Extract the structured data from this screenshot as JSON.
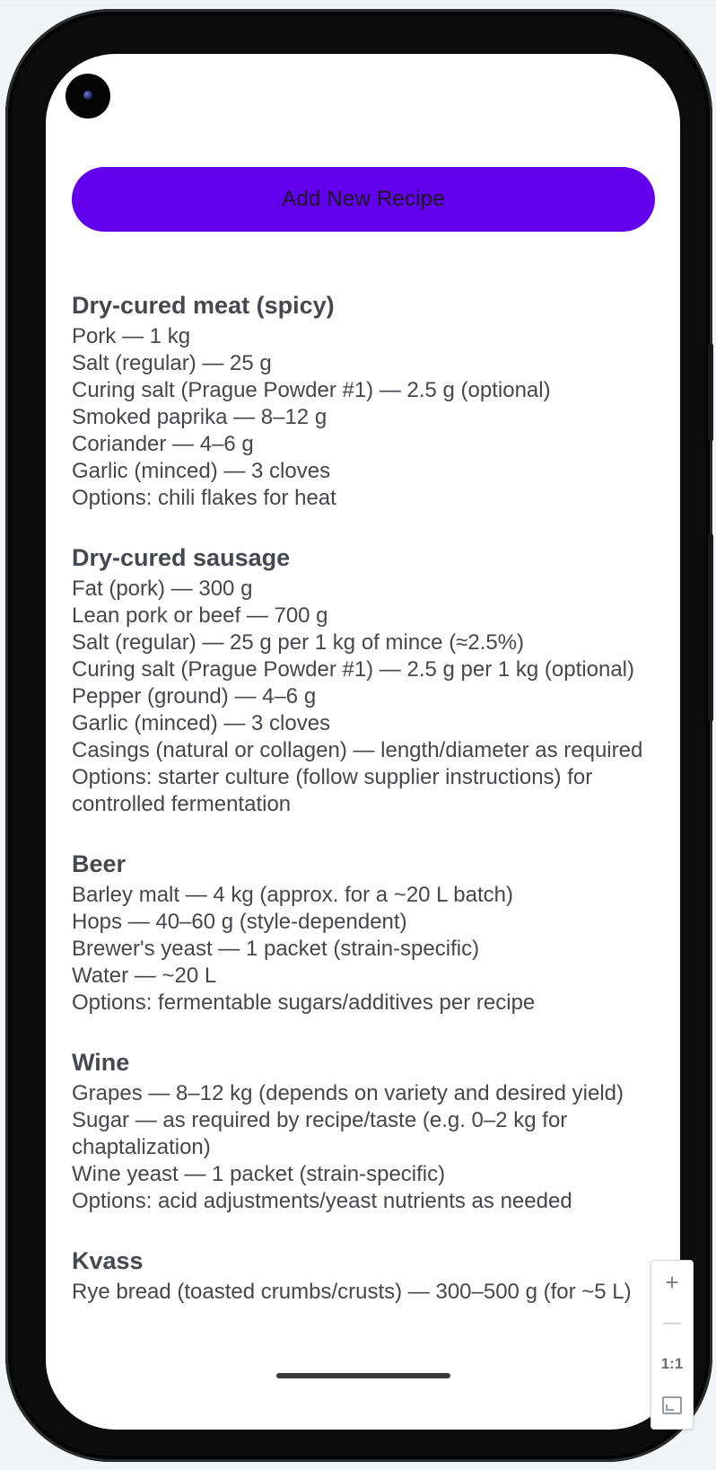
{
  "button": {
    "add_recipe": "Add New Recipe"
  },
  "recipes": [
    {
      "title": "Dry-cured meat (spicy)",
      "lines": [
        "Pork — 1 kg",
        "Salt (regular) — 25 g",
        "Curing salt (Prague Powder #1) — 2.5 g (optional)",
        "Smoked paprika — 8–12 g",
        "Coriander — 4–6 g",
        "Garlic (minced) — 3 cloves",
        "Options: chili flakes for heat"
      ]
    },
    {
      "title": "Dry-cured sausage",
      "lines": [
        "Fat (pork) — 300 g",
        "Lean pork or beef — 700 g",
        "Salt (regular) — 25 g per 1 kg of mince (≈2.5%)",
        "Curing salt (Prague Powder #1) — 2.5 g per 1 kg (optional)",
        "Pepper (ground) — 4–6 g",
        "Garlic (minced) — 3 cloves",
        "Casings (natural or collagen) — length/diameter as required",
        "Options: starter culture (follow supplier instructions) for controlled fermentation"
      ]
    },
    {
      "title": "Beer",
      "lines": [
        "Barley malt — 4 kg (approx. for a ~20 L batch)",
        "Hops — 40–60 g (style-dependent)",
        "Brewer's yeast — 1 packet (strain-specific)",
        "Water — ~20 L",
        "Options: fermentable sugars/additives per recipe"
      ]
    },
    {
      "title": "Wine",
      "lines": [
        "Grapes — 8–12 kg (depends on variety and desired yield)",
        "Sugar — as required by recipe/taste (e.g. 0–2 kg for chaptalization)",
        "Wine yeast — 1 packet (strain-specific)",
        "Options: acid adjustments/yeast nutrients as needed"
      ]
    },
    {
      "title": "Kvass",
      "lines": [
        "Rye bread (toasted crumbs/crusts) — 300–500 g (for ~5 L)"
      ]
    }
  ],
  "zoom_controls": {
    "zoom_in": "+",
    "zoom_out": "—",
    "ratio": "1:1"
  },
  "colors": {
    "accent": "#6200ee",
    "text": "#46464d",
    "frame": "#0c0c0c"
  }
}
